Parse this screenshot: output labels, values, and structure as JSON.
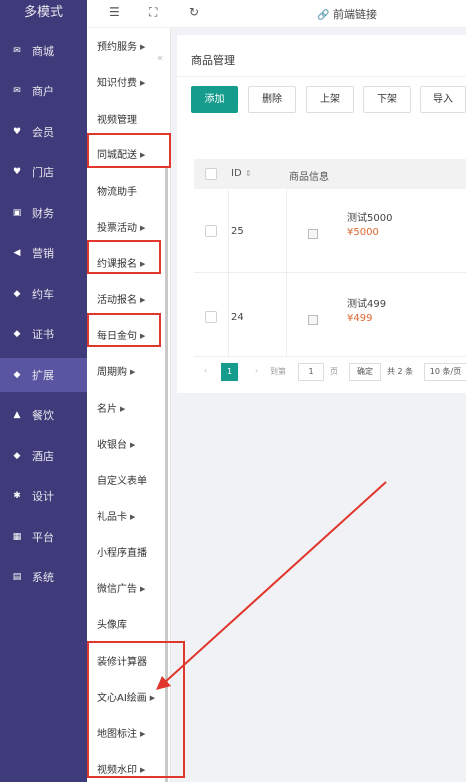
{
  "nav": {
    "brand": "多模式",
    "items": [
      {
        "label": "商城",
        "icon": "mail-icon"
      },
      {
        "label": "商户",
        "icon": "mail-icon"
      },
      {
        "label": "会员",
        "icon": "heart-icon"
      },
      {
        "label": "门店",
        "icon": "heart-icon"
      },
      {
        "label": "财务",
        "icon": "wallet-icon"
      },
      {
        "label": "营销",
        "icon": "megaphone-icon"
      },
      {
        "label": "约车",
        "icon": "cube-icon"
      },
      {
        "label": "证书",
        "icon": "cube-icon"
      },
      {
        "label": "扩展",
        "icon": "cube-icon",
        "active": true
      },
      {
        "label": "餐饮",
        "icon": "tray-icon"
      },
      {
        "label": "酒店",
        "icon": "cube-icon"
      },
      {
        "label": "设计",
        "icon": "puzzle-icon"
      },
      {
        "label": "平台",
        "icon": "grid-icon"
      },
      {
        "label": "系统",
        "icon": "monitor-icon"
      }
    ]
  },
  "submenu": {
    "items": [
      {
        "label": "预约服务",
        "caret": true
      },
      {
        "label": "知识付费",
        "caret": true
      },
      {
        "label": "视频管理",
        "caret": false
      },
      {
        "label": "同城配送",
        "caret": true
      },
      {
        "label": "物流助手",
        "caret": false
      },
      {
        "label": "投票活动",
        "caret": true
      },
      {
        "label": "约课报名",
        "caret": true
      },
      {
        "label": "活动报名",
        "caret": true
      },
      {
        "label": "每日金句",
        "caret": true
      },
      {
        "label": "周期购",
        "caret": true
      },
      {
        "label": "名片",
        "caret": true
      },
      {
        "label": "收银台",
        "caret": true
      },
      {
        "label": "自定义表单",
        "caret": false
      },
      {
        "label": "礼品卡",
        "caret": true
      },
      {
        "label": "小程序直播",
        "caret": false
      },
      {
        "label": "微信广告",
        "caret": true
      },
      {
        "label": "头像库",
        "caret": false
      },
      {
        "label": "装修计算器",
        "caret": false
      },
      {
        "label": "文心AI绘画",
        "caret": true
      },
      {
        "label": "地图标注",
        "caret": true
      },
      {
        "label": "视频水印",
        "caret": true
      }
    ]
  },
  "topbar": {
    "link_label": "前端链接"
  },
  "panel": {
    "title": "商品管理",
    "buttons": [
      "添加",
      "删除",
      "上架",
      "下架",
      "导入"
    ],
    "columns": {
      "id": "ID",
      "info": "商品信息"
    },
    "rows": [
      {
        "id": "25",
        "name": "测试5000",
        "price": "¥5000"
      },
      {
        "id": "24",
        "name": "测试499",
        "price": "¥499"
      }
    ],
    "pager": {
      "current": "1",
      "goto_label": "到第",
      "page_input": "1",
      "page_unit": "页",
      "confirm": "确定",
      "total": "共 2 条",
      "page_size": "10 条/页"
    }
  },
  "colors": {
    "nav_bg": "#3f3a79",
    "accent": "#169c8c",
    "price": "#e0662f",
    "annotation": "#e0362c"
  }
}
